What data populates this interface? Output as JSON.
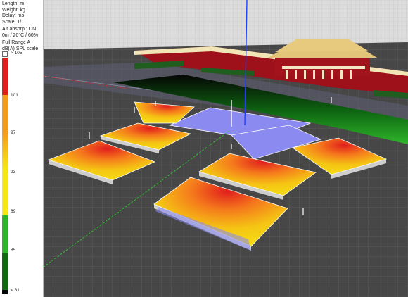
{
  "info": {
    "length": "Length: m",
    "weight": "Weight: kg",
    "delay": "Delay: ms",
    "scale": "Scale: 1/1",
    "air_absorp": "Air absorp.: ON",
    "conditions": "0m / 20°C / 60%",
    "range": "Full Range A",
    "scale_name": "dB(A) SPL scale"
  },
  "legend": {
    "over": "> 105",
    "under": "< 81",
    "ticks": [
      "101",
      "97",
      "93",
      "89",
      "85"
    ],
    "colors": {
      "red": "#e11d1d",
      "orange": "#f59b1c",
      "yellow": "#f5e614",
      "green": "#2fb52a",
      "dark_green": "#0f6a12",
      "black": "#050505"
    }
  },
  "scene": {
    "ground_color": "#474747",
    "grid_color": "#5c5c5c",
    "sky_color": "#d8d8d8",
    "listening_plane_color": "#8a8af0",
    "gate_roof_color": "#e3c57a",
    "gate_wall_color": "#a3131c",
    "axis_blue": "#2040ff",
    "axis_green": "#2bd02b",
    "axis_red": "#d02b2b"
  }
}
